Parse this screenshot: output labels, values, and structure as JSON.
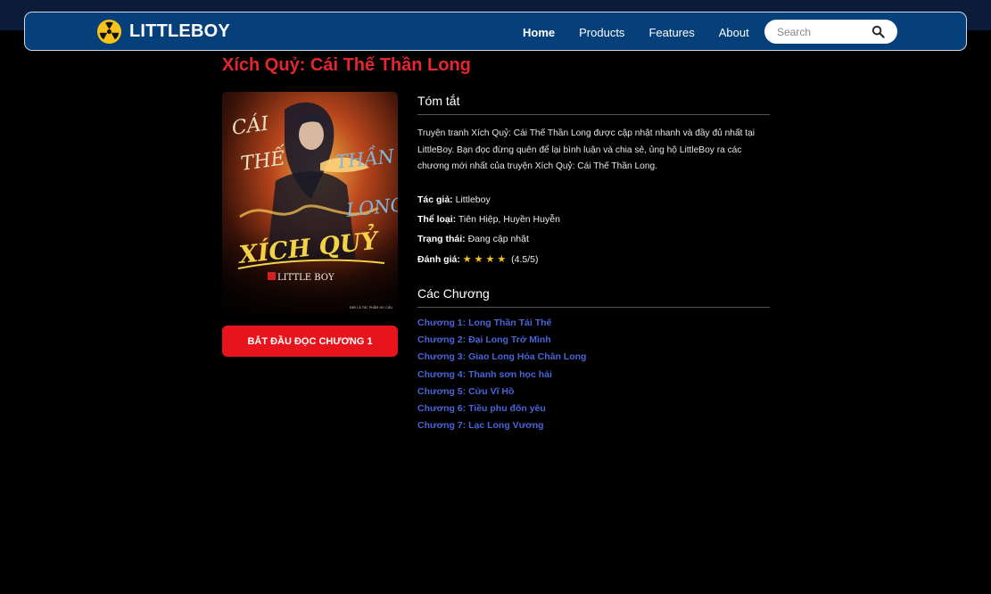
{
  "brand": {
    "name": "LITTLEBOY",
    "logo_icon": "radiation-icon"
  },
  "nav": {
    "links": [
      "Home",
      "Products",
      "Features",
      "About"
    ],
    "active": "Home",
    "search_placeholder": "Search",
    "search_icon": "search-icon"
  },
  "comic": {
    "title": "Xích Quỷ: Cái Thế Thần Long",
    "cover": {
      "line1": "CÁI",
      "line2": "THẾ",
      "line3": "THẦN",
      "line4": "LONG",
      "script_title": "XÍCH QUỶ",
      "brand": "LITTLE BOY",
      "footnote": "ĐÂY LÀ TÁC PHẨM HƯ CẤU"
    },
    "start_button": "BẮT ĐẦU ĐỌC CHƯƠNG 1",
    "summary_heading": "Tóm tắt",
    "summary": "Truyện tranh Xích Quỷ: Cái Thế Thần Long được cập nhật nhanh và đầy đủ nhất tại LittleBoy. Bạn đọc đừng quên để lại bình luận và chia sẻ, ủng hộ LittleBoy ra các chương mới nhất của truyện Xích Quỷ: Cái Thế Thần Long.",
    "meta": {
      "author_label": "Tác giả:",
      "author": "Littleboy",
      "genre_label": "Thể loại:",
      "genre": "Tiên Hiệp, Huyền Huyễn",
      "status_label": "Trạng thái:",
      "status": "Đang cập nhật",
      "rating_label": "Đánh giá:",
      "rating_stars": "★★★★",
      "rating_text": "(4.5/5)",
      "rating_value": 4.5
    },
    "chapters_heading": "Các Chương",
    "chapters": [
      "Chương 1: Long Thần Tái Thế",
      "Chương 2: Đại Long Trở Mình",
      "Chương 3: Giao Long Hóa Chân Long",
      "Chương 4: Thanh sơn học hải",
      "Chương 5: Cửu Vĩ Hồ",
      "Chương 6: Tiều phu đốn yêu",
      "Chương 7: Lạc Long Vương"
    ]
  },
  "colors": {
    "navbar": "#06407a",
    "title_red": "#e52630",
    "button_red": "#e8141c",
    "chapter_link": "#4a64d8",
    "star": "#f5c518"
  }
}
